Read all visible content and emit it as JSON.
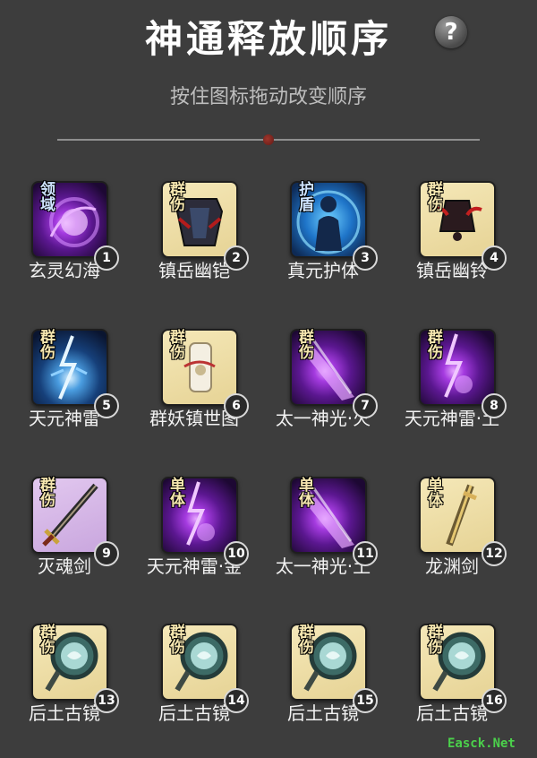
{
  "header": {
    "title": "神通释放顺序",
    "help_icon_glyph": "?",
    "subtitle": "按住图标拖动改变顺序"
  },
  "skills": [
    {
      "name": "玄灵幻海",
      "order": "1",
      "tag": "领域",
      "icon": "purple-vortex-icon",
      "bg": "purple"
    },
    {
      "name": "镇岳幽铠",
      "order": "2",
      "tag": "群伤",
      "icon": "dark-armor-icon",
      "bg": "cream"
    },
    {
      "name": "真元护体",
      "order": "3",
      "tag": "护盾",
      "icon": "blue-shield-aura-icon",
      "bg": "blue"
    },
    {
      "name": "镇岳幽铃",
      "order": "4",
      "tag": "群伤",
      "icon": "dark-bell-icon",
      "bg": "cream"
    },
    {
      "name": "天元神雷",
      "order": "5",
      "tag": "群伤",
      "icon": "blue-thunder-icon",
      "bg": "darkblue"
    },
    {
      "name": "群妖镇世图",
      "order": "6",
      "tag": "群伤",
      "icon": "scroll-icon",
      "bg": "cream"
    },
    {
      "name": "太一神光·火",
      "order": "7",
      "tag": "群伤",
      "icon": "purple-light-beam-icon",
      "bg": "purple"
    },
    {
      "name": "天元神雷·土",
      "order": "8",
      "tag": "群伤",
      "icon": "purple-thunder-icon",
      "bg": "purple"
    },
    {
      "name": "灭魂剑",
      "order": "9",
      "tag": "群伤",
      "icon": "sword-icon",
      "bg": "lilac"
    },
    {
      "name": "天元神雷·金",
      "order": "10",
      "tag": "单体",
      "icon": "purple-thunder-icon",
      "bg": "purple"
    },
    {
      "name": "太一神光·土",
      "order": "11",
      "tag": "单体",
      "icon": "purple-light-beam-icon",
      "bg": "purple"
    },
    {
      "name": "龙渊剑",
      "order": "12",
      "tag": "单体",
      "icon": "golden-sword-icon",
      "bg": "cream"
    },
    {
      "name": "后土古镜",
      "order": "13",
      "tag": "群伤",
      "icon": "ancient-mirror-icon",
      "bg": "cream"
    },
    {
      "name": "后土古镜",
      "order": "14",
      "tag": "群伤",
      "icon": "ancient-mirror-icon",
      "bg": "cream"
    },
    {
      "name": "后土古镜",
      "order": "15",
      "tag": "群伤",
      "icon": "ancient-mirror-icon",
      "bg": "cream"
    },
    {
      "name": "后土古镜",
      "order": "16",
      "tag": "群伤",
      "icon": "ancient-mirror-icon",
      "bg": "cream"
    }
  ],
  "watermark": "Easck.Net",
  "colors": {
    "background": "#3d3d3d",
    "cream_frame": "#ecdca6",
    "purple_frame": "#4a1a6e",
    "tag_text": "#f6e7b0"
  }
}
